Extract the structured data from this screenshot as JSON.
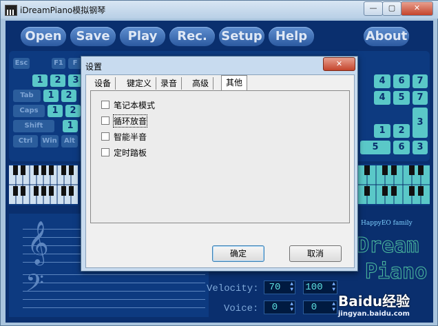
{
  "window": {
    "title": "iDreamPiano模拟钢琴"
  },
  "nav": [
    "Open",
    "Save",
    "Play",
    "Rec.",
    "Setup",
    "Help",
    "About"
  ],
  "keyboard": {
    "esc": "Esc",
    "f1": "F1",
    "f2": "F",
    "tab": "Tab",
    "caps": "Caps",
    "shift": "Shift",
    "ctrl": "Ctrl",
    "win": "Win",
    "alt": "Alt",
    "left_row1": [
      "1",
      "2",
      "3"
    ],
    "left_row2": [
      "1",
      "2"
    ],
    "left_row3": [
      "1",
      "2"
    ],
    "left_row4": [
      "1"
    ],
    "right_grid": [
      [
        "4",
        "6",
        "7"
      ],
      [
        "4",
        "5",
        "7"
      ],
      [
        "1",
        "2",
        "3"
      ],
      [
        "5",
        "6"
      ]
    ],
    "right_col4": [
      "3"
    ]
  },
  "controls": {
    "velocity_label": "Velocity:",
    "velocity_value": "70",
    "velocity_value2": "100",
    "voice_label": "Voice:",
    "voice_value": "0",
    "voice_value2": "0"
  },
  "brand": {
    "family": "HappyEO family",
    "line1": "Dream",
    "line2": "Piano"
  },
  "watermark": {
    "logo": "Baidu经验",
    "url": "jingyan.baidu.com"
  },
  "dialog": {
    "title": "设置",
    "tabs": [
      "设备",
      "键定义",
      "录音",
      "高级",
      "其他"
    ],
    "active_tab": "其他",
    "options": [
      {
        "label": "笔记本模式",
        "checked": false
      },
      {
        "label": "循环放音",
        "checked": false
      },
      {
        "label": "智能半音",
        "checked": false
      },
      {
        "label": "定时踏板",
        "checked": false
      }
    ],
    "ok_label": "确定",
    "cancel_label": "取消",
    "close_label": "✕"
  },
  "icons": [
    "app-icon",
    "minimize-icon",
    "maximize-icon",
    "close-icon",
    "treble-clef-icon",
    "bass-clef-icon"
  ],
  "colors": {
    "app_bg": "#0a2f6e",
    "key_accent": "#5ac8c8",
    "digit_readout": "#5fe0e0"
  }
}
